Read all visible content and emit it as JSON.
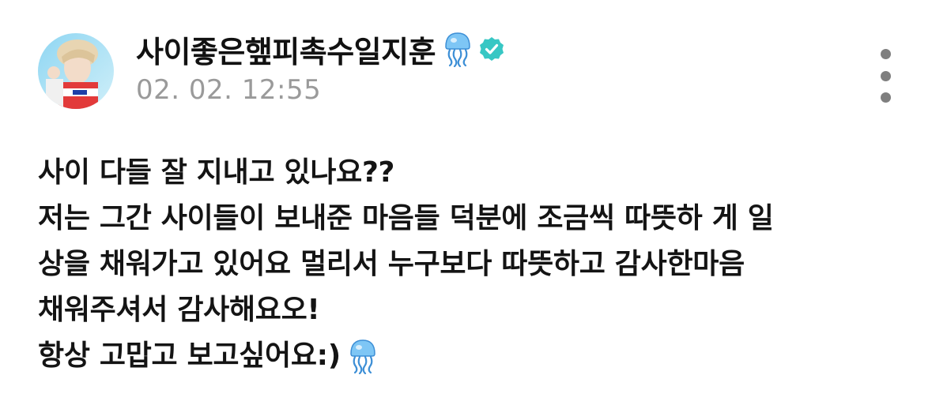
{
  "post": {
    "author_name": "사이좋은햎피촉수일지훈",
    "timestamp": "02. 02. 12:55",
    "badges": {
      "name_emoji": "jellyfish-icon",
      "verified": "verified-check-icon",
      "verified_color": "#37c7c4"
    },
    "more_menu_icon": "more-vertical-icon",
    "body_lines": [
      "사이 다들 잘 지내고 있나요??",
      "저는 그간 사이들이 보내준 마음들 덕분에 조금씩 따뜻하 게 일",
      "상을 채워가고 있어요 멀리서 누구보다 따뜻하고 감사한마음",
      "채워주셔서 감사해요오!",
      "항상 고맙고 보고싶어요:)"
    ],
    "trailing_emoji": "jellyfish-icon"
  }
}
